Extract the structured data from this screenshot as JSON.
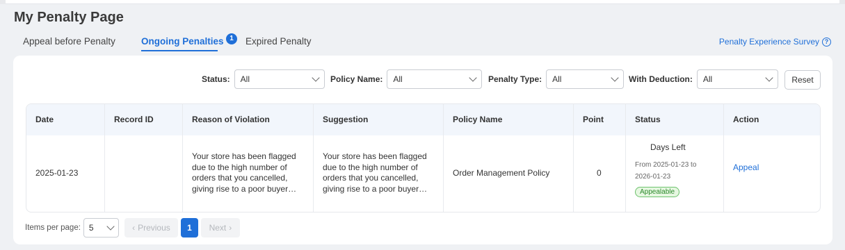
{
  "page": {
    "title": "My Penalty Page"
  },
  "tabs": [
    {
      "label": "Appeal before Penalty"
    },
    {
      "label": "Ongoing Penalties",
      "badge": "1"
    },
    {
      "label": "Expired Penalty"
    }
  ],
  "survey": {
    "label": "Penalty Experience Survey",
    "icon": "help-icon"
  },
  "filters": {
    "status": {
      "label": "Status:",
      "value": "All"
    },
    "policy_name": {
      "label": "Policy Name:",
      "value": "All"
    },
    "penalty_type": {
      "label": "Penalty Type:",
      "value": "All"
    },
    "with_deduction": {
      "label": "With Deduction:",
      "value": "All"
    },
    "reset_label": "Reset"
  },
  "table": {
    "columns": [
      "Date",
      "Record ID",
      "Reason of Violation",
      "Suggestion",
      "Policy Name",
      "Point",
      "Status",
      "Action"
    ],
    "rows": [
      {
        "date": "2025-01-23",
        "record_id": "",
        "reason": "Your store has been flagged due to the high number of orders that you cancelled, giving rise to a poor buyer…",
        "suggestion": "Your store has been flagged due to the high number of orders that you cancelled, giving rise to a poor buyer…",
        "policy_name": "Order Management Policy",
        "point": "0",
        "status_days_left": "Days Left",
        "status_range": "From 2025-01-23 to 2026-01-23",
        "status_badge": "Appealable",
        "action": "Appeal"
      }
    ]
  },
  "pagination": {
    "items_label": "Items per page:",
    "page_size": "5",
    "previous_label": "Previous",
    "current_page": "1",
    "next_label": "Next"
  },
  "colors": {
    "accent": "#1f6fd8",
    "success": "#2d8a2d"
  }
}
